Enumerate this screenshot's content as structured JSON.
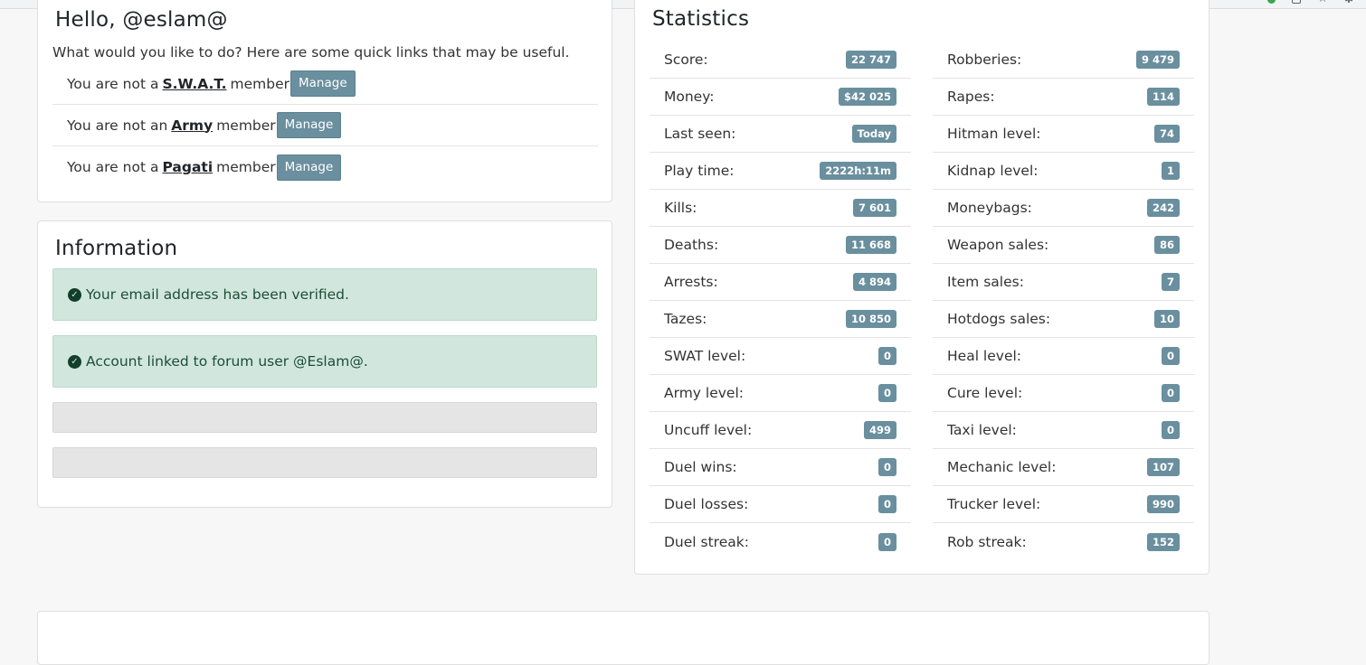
{
  "greeting": {
    "title": "Hello, @eslam@",
    "intro": "What would you like to do? Here are some quick links that may be useful.",
    "memberships": [
      {
        "prefix": "You are not a",
        "group": "S.W.A.T.",
        "suffix": "member",
        "button": "Manage"
      },
      {
        "prefix": "You are not an",
        "group": "Army",
        "suffix": "member",
        "button": "Manage"
      },
      {
        "prefix": "You are not a",
        "group": "Pagati",
        "suffix": "member",
        "button": "Manage"
      }
    ]
  },
  "information": {
    "title": "Information",
    "alerts": [
      "Your email address has been verified.",
      "Account linked to forum user @Eslam@."
    ]
  },
  "statistics": {
    "title": "Statistics",
    "left": [
      {
        "label": "Score:",
        "value": "22 747"
      },
      {
        "label": "Money:",
        "value": "$42 025"
      },
      {
        "label": "Last seen:",
        "value": "Today"
      },
      {
        "label": "Play time:",
        "value": "2222h:11m"
      },
      {
        "label": "Kills:",
        "value": "7 601"
      },
      {
        "label": "Deaths:",
        "value": "11 668"
      },
      {
        "label": "Arrests:",
        "value": "4 894"
      },
      {
        "label": "Tazes:",
        "value": "10 850"
      },
      {
        "label": "SWAT level:",
        "value": "0"
      },
      {
        "label": "Army level:",
        "value": "0"
      },
      {
        "label": "Uncuff level:",
        "value": "499"
      },
      {
        "label": "Duel wins:",
        "value": "0"
      },
      {
        "label": "Duel losses:",
        "value": "0"
      },
      {
        "label": "Duel streak:",
        "value": "0"
      }
    ],
    "right": [
      {
        "label": "Robberies:",
        "value": "9 479"
      },
      {
        "label": "Rapes:",
        "value": "114"
      },
      {
        "label": "Hitman level:",
        "value": "74"
      },
      {
        "label": "Kidnap level:",
        "value": "1"
      },
      {
        "label": "Moneybags:",
        "value": "242"
      },
      {
        "label": "Weapon sales:",
        "value": "86"
      },
      {
        "label": "Item sales:",
        "value": "7"
      },
      {
        "label": "Hotdogs sales:",
        "value": "10"
      },
      {
        "label": "Heal level:",
        "value": "0"
      },
      {
        "label": "Cure level:",
        "value": "0"
      },
      {
        "label": "Taxi level:",
        "value": "0"
      },
      {
        "label": "Mechanic level:",
        "value": "107"
      },
      {
        "label": "Trucker level:",
        "value": "990"
      },
      {
        "label": "Rob streak:",
        "value": "152"
      }
    ]
  },
  "colors": {
    "badge": "#6a8f9e",
    "alert_bg": "#d1e7dd",
    "check": "#123f2c"
  }
}
